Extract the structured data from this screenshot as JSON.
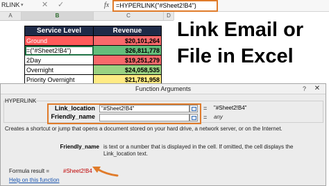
{
  "formula_bar": {
    "name_box": "RLINK",
    "cancel_icon": "✕",
    "enter_icon": "✓",
    "fx_label": "fx",
    "formula": "=HYPERLINK(\"#Sheet2!B4\")"
  },
  "sheet": {
    "column_headers": [
      "A",
      "B",
      "C",
      "D"
    ],
    "table": {
      "headers": [
        "Service Level",
        "Revenue"
      ],
      "rows": [
        {
          "level": "Ground",
          "revenue": "$20,101,264",
          "level_color": "#ff5a5a",
          "level_text_color": "#ffffff",
          "rev_color": "#f8696b",
          "selected": false
        },
        {
          "level": "=(\"#Sheet2!B4\")",
          "revenue": "$26,811,778",
          "level_color": "#ffffff",
          "level_text_color": "#000000",
          "rev_color": "#63be7b",
          "selected": true
        },
        {
          "level": "2Day",
          "revenue": "$19,251,279",
          "level_color": "#ffffff",
          "level_text_color": "#000000",
          "rev_color": "#f8696b",
          "selected": false
        },
        {
          "level": "Overnight",
          "revenue": "$24,058,535",
          "level_color": "#ffffff",
          "level_text_color": "#000000",
          "rev_color": "#9bd282",
          "selected": false
        },
        {
          "level": "Priority Overnight",
          "revenue": "$21,781,958",
          "level_color": "#ffffff",
          "level_text_color": "#000000",
          "rev_color": "#ffeb84",
          "selected": false
        }
      ]
    }
  },
  "title": "Link Email or File in Excel",
  "dialog": {
    "title": "Function Arguments",
    "help_icon": "?",
    "close_icon": "✕",
    "function_name": "HYPERLINK",
    "args": [
      {
        "label": "Link_location",
        "input": "\"#Sheet2!B4\"",
        "value": "\"#Sheet2!B4\""
      },
      {
        "label": "Friendly_name",
        "input": "",
        "value": "any"
      }
    ],
    "equals": "=",
    "description": "Creates a shortcut or jump that opens a document stored on your hard drive, a network server, or on the Internet.",
    "param_name": "Friendly_name",
    "param_desc": "is text or a number that is displayed in the cell. If omitted, the cell displays the Link_location text.",
    "result_label": "Formula result =",
    "result_value": "#Sheet2!B4",
    "help_link": "Help on this function"
  },
  "colors": {
    "highlight": "#e07b2a",
    "header_bg": "#1f2b48",
    "result_red": "#c00000",
    "link_blue": "#1a55b0"
  }
}
